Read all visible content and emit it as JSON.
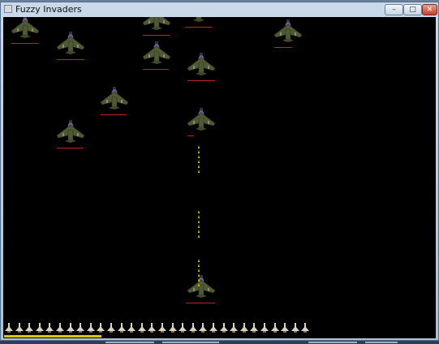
{
  "window": {
    "title": "Fuzzy Invaders",
    "app_icon": "app-icon",
    "buttons": [
      {
        "name": "minimize-button",
        "glyph": "–"
      },
      {
        "name": "maximize-button",
        "glyph": "□"
      },
      {
        "name": "close-button",
        "glyph": "✕"
      }
    ]
  },
  "game": {
    "sprite": "fighter-plane",
    "colors": {
      "background": "#000000",
      "plane_body": "#4f5a34",
      "plane_cockpit": "#6a5a9a",
      "health_bar": "#c02020",
      "bullet": "#e8e000",
      "life_icon": "#d8d4c4",
      "ammo": "#d8c800"
    },
    "enemies_visible": 11,
    "bullets_visible": 18,
    "lives_remaining": 30,
    "ammo_pips": 40
  }
}
